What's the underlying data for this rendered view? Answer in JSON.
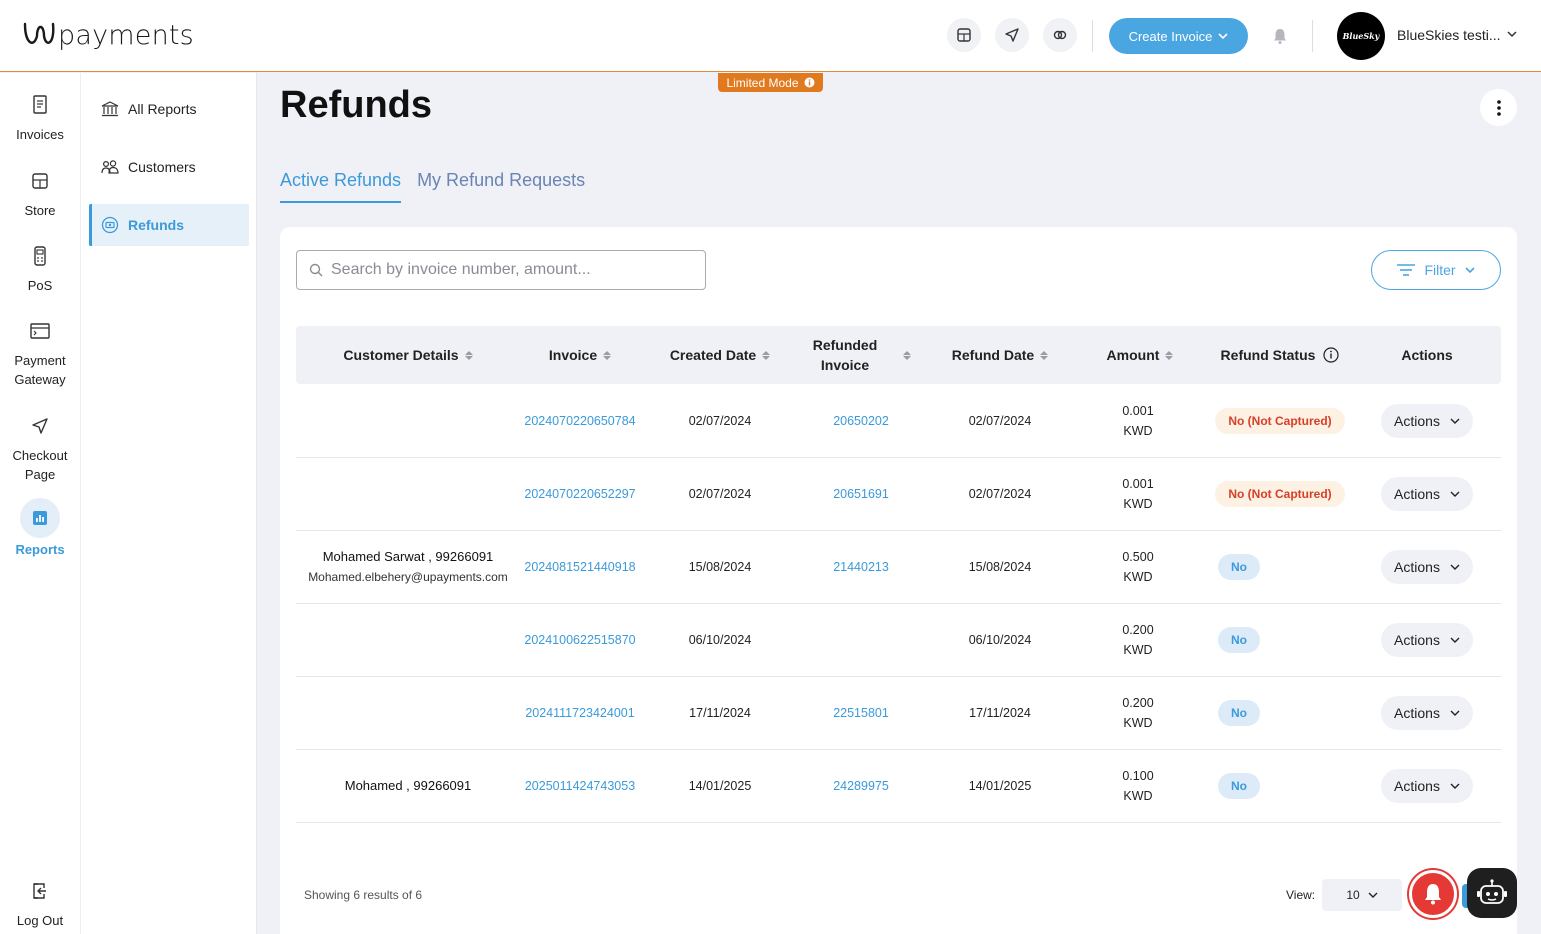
{
  "brand": {
    "logo_text": "payments"
  },
  "header": {
    "create_invoice_label": "Create Invoice",
    "account_name": "BlueSkies testi...",
    "avatar_text": "BlueSky"
  },
  "rail": {
    "items": [
      {
        "label": "Invoices"
      },
      {
        "label": "Store"
      },
      {
        "label": "PoS"
      },
      {
        "label": "Payment Gateway"
      },
      {
        "label": "Checkout Page"
      },
      {
        "label": "Reports"
      }
    ],
    "logout_label": "Log Out"
  },
  "subnav": {
    "items": [
      {
        "label": "All Reports"
      },
      {
        "label": "Customers"
      },
      {
        "label": "Refunds"
      }
    ]
  },
  "limited_mode_label": "Limited Mode",
  "page": {
    "title": "Refunds",
    "tabs": [
      {
        "label": "Active Refunds"
      },
      {
        "label": "My Refund Requests"
      }
    ],
    "search_placeholder": "Search by invoice number, amount...",
    "filter_label": "Filter"
  },
  "table": {
    "columns": [
      {
        "label": "Customer Details"
      },
      {
        "label": "Invoice"
      },
      {
        "label": "Created Date"
      },
      {
        "label": "Refunded Invoice"
      },
      {
        "label": "Refund Date"
      },
      {
        "label": "Amount"
      },
      {
        "label": "Refund Status"
      },
      {
        "label": "Actions"
      }
    ],
    "rows": [
      {
        "customer_name": "",
        "customer_email": "",
        "invoice": "2024070220650784",
        "created": "02/07/2024",
        "refunded_invoice": "20650202",
        "refund_date": "02/07/2024",
        "amount": "0.001",
        "currency": "KWD",
        "status": "No (Not Captured)",
        "status_kind": "nc",
        "actions": "Actions"
      },
      {
        "customer_name": "",
        "customer_email": "",
        "invoice": "2024070220652297",
        "created": "02/07/2024",
        "refunded_invoice": "20651691",
        "refund_date": "02/07/2024",
        "amount": "0.001",
        "currency": "KWD",
        "status": "No (Not Captured)",
        "status_kind": "nc",
        "actions": "Actions"
      },
      {
        "customer_name": "Mohamed Sarwat , 99266091",
        "customer_email": "Mohamed.elbehery@upayments.com",
        "invoice": "2024081521440918",
        "created": "15/08/2024",
        "refunded_invoice": "21440213",
        "refund_date": "15/08/2024",
        "amount": "0.500",
        "currency": "KWD",
        "status": "No",
        "status_kind": "no",
        "actions": "Actions"
      },
      {
        "customer_name": "",
        "customer_email": "",
        "invoice": "2024100622515870",
        "created": "06/10/2024",
        "refunded_invoice": "",
        "refund_date": "06/10/2024",
        "amount": "0.200",
        "currency": "KWD",
        "status": "No",
        "status_kind": "no",
        "actions": "Actions"
      },
      {
        "customer_name": "",
        "customer_email": "",
        "invoice": "2024111723424001",
        "created": "17/11/2024",
        "refunded_invoice": "22515801",
        "refund_date": "17/11/2024",
        "amount": "0.200",
        "currency": "KWD",
        "status": "No",
        "status_kind": "no",
        "actions": "Actions"
      },
      {
        "customer_name": "Mohamed , 99266091",
        "customer_email": "",
        "invoice": "2025011424743053",
        "created": "14/01/2025",
        "refunded_invoice": "24289975",
        "refund_date": "14/01/2025",
        "amount": "0.100",
        "currency": "KWD",
        "status": "No",
        "status_kind": "no",
        "actions": "Actions"
      }
    ]
  },
  "footer": {
    "showing_text": "Showing 6 results of 6",
    "view_label": "View:",
    "view_value": "10"
  },
  "colors": {
    "accent": "#4aa6e0",
    "brand_orange": "#e17a1f",
    "status_red": "#d64028"
  }
}
